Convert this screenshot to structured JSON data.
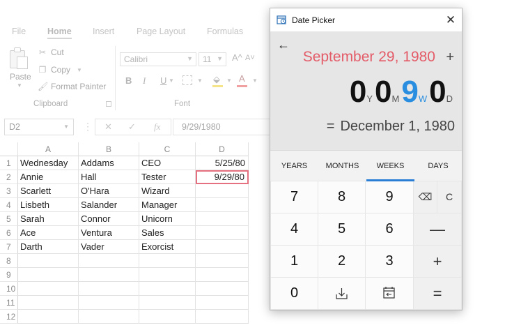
{
  "excel": {
    "tabs": [
      "File",
      "Home",
      "Insert",
      "Page Layout",
      "Formulas"
    ],
    "clipboard": {
      "paste_label": "Paste",
      "cut_label": "Cut",
      "copy_label": "Copy",
      "format_painter_label": "Format Painter",
      "group_label": "Clipboard"
    },
    "font": {
      "family": "Calibri",
      "size": "11",
      "group_label": "Font",
      "grow": "A^",
      "shrink": "A˅",
      "bold": "B",
      "italic": "I",
      "underline": "U"
    },
    "name_box": "D2",
    "fx_label": "fx",
    "formula_value": "9/29/1980",
    "columns": [
      "A",
      "B",
      "C",
      "D"
    ],
    "rows": [
      {
        "n": "1",
        "a": "Wednesday",
        "b": "Addams",
        "c": "CEO",
        "d": "5/25/80"
      },
      {
        "n": "2",
        "a": "Annie",
        "b": "Hall",
        "c": "Tester",
        "d": "9/29/80"
      },
      {
        "n": "3",
        "a": "Scarlett",
        "b": "O'Hara",
        "c": "Wizard",
        "d": ""
      },
      {
        "n": "4",
        "a": "Lisbeth",
        "b": "Salander",
        "c": "Manager",
        "d": ""
      },
      {
        "n": "5",
        "a": "Sarah",
        "b": "Connor",
        "c": "Unicorn",
        "d": ""
      },
      {
        "n": "6",
        "a": "Ace",
        "b": "Ventura",
        "c": "Sales",
        "d": ""
      },
      {
        "n": "7",
        "a": "Darth",
        "b": "Vader",
        "c": "Exorcist",
        "d": ""
      },
      {
        "n": "8",
        "a": "",
        "b": "",
        "c": "",
        "d": ""
      },
      {
        "n": "9",
        "a": "",
        "b": "",
        "c": "",
        "d": ""
      },
      {
        "n": "10",
        "a": "",
        "b": "",
        "c": "",
        "d": ""
      },
      {
        "n": "11",
        "a": "",
        "b": "",
        "c": "",
        "d": ""
      },
      {
        "n": "12",
        "a": "",
        "b": "",
        "c": "",
        "d": ""
      }
    ],
    "selected_cell": "D2"
  },
  "date_picker": {
    "title": "Date Picker",
    "close_glyph": "✕",
    "back_glyph": "←",
    "from_date": "September 29, 1980",
    "operator": "+",
    "duration": [
      {
        "value": "0",
        "unit": "Y",
        "selected": false
      },
      {
        "value": "0",
        "unit": "M",
        "selected": false
      },
      {
        "value": "9",
        "unit": "W",
        "selected": true
      },
      {
        "value": "0",
        "unit": "D",
        "selected": false
      }
    ],
    "equals": "=",
    "result": "December 1, 1980",
    "tabs": [
      {
        "label": "YEARS",
        "active": false
      },
      {
        "label": "MONTHS",
        "active": false
      },
      {
        "label": "WEEKS",
        "active": true
      },
      {
        "label": "DAYS",
        "active": false
      }
    ],
    "keys": {
      "k7": "7",
      "k8": "8",
      "k9": "9",
      "backspace": "⌫",
      "clear": "C",
      "k4": "4",
      "k5": "5",
      "k6": "6",
      "minus": "—",
      "k1": "1",
      "k2": "2",
      "k3": "3",
      "plus": "+",
      "k0": "0",
      "equals": "="
    },
    "colors": {
      "accent": "#2a8ee0",
      "from_date": "#e45b68",
      "selection": "#e57180"
    }
  }
}
